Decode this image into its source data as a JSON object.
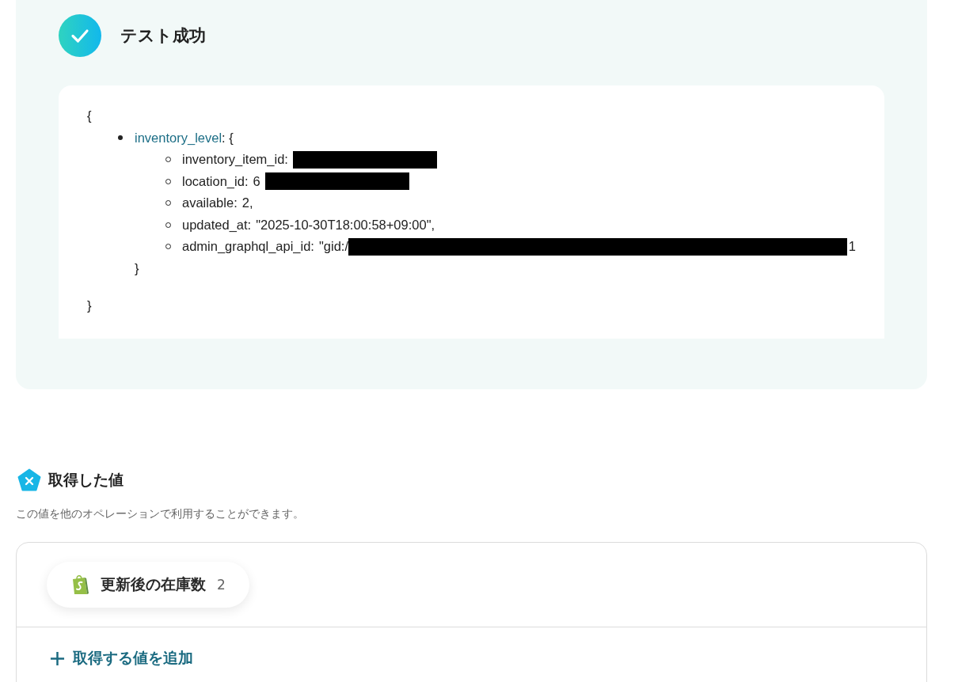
{
  "test_result": {
    "title": "テスト成功",
    "success": true,
    "open_brace": "{",
    "close_brace": "}",
    "root_key": "inventory_level",
    "root_open": ": {",
    "root_close": "}",
    "fields": [
      {
        "key": "inventory_item_id:",
        "redacted": true
      },
      {
        "key": "location_id:",
        "value": "6",
        "redacted": true
      },
      {
        "key": "available:",
        "value": "2,"
      },
      {
        "key": "updated_at:",
        "value": "\"2025-10-30T18:00:58+09:00\","
      },
      {
        "key": "admin_graphql_api_id:",
        "value": "\"gid:/",
        "redacted": true,
        "value_end": "1"
      }
    ]
  },
  "obtained_values": {
    "title": "取得した値",
    "description": "この値を他のオペレーションで利用することができます。",
    "chips": [
      {
        "label": "更新後の在庫数",
        "value": "2"
      }
    ],
    "add_button": "取得する値を追加"
  }
}
